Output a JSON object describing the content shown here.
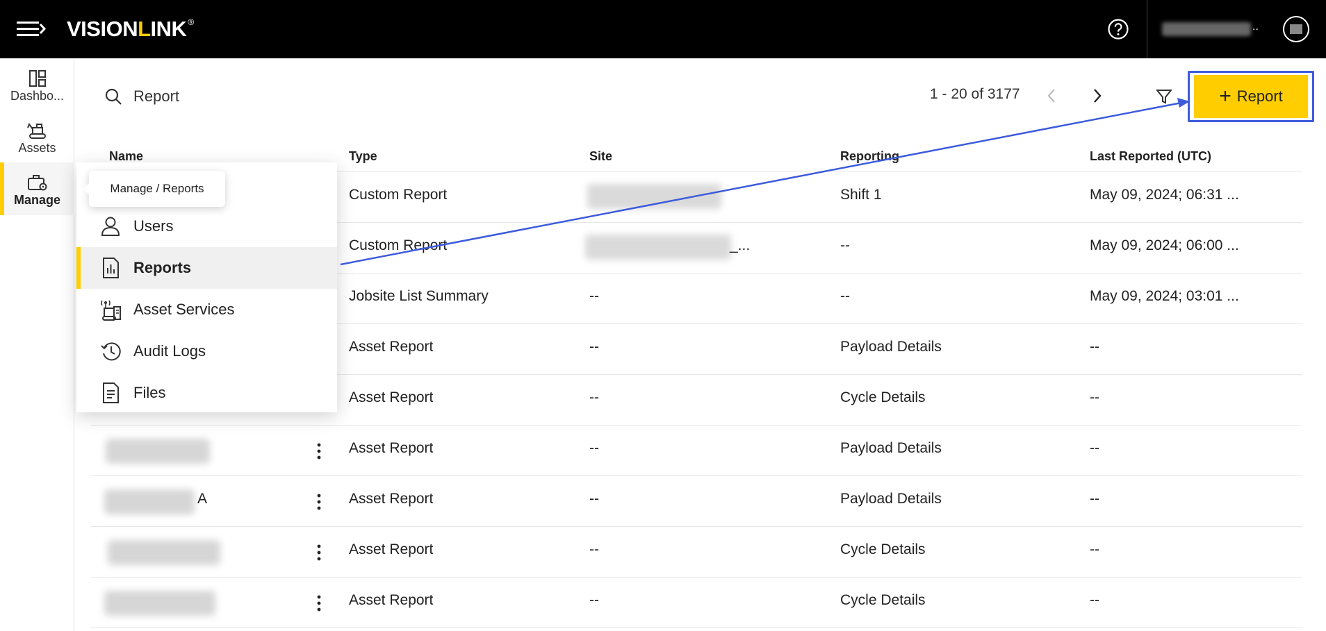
{
  "header": {
    "logo_text_1": "VISION",
    "logo_text_l": "L",
    "logo_text_2": "INK",
    "logo_reg": "®",
    "user_ellipsis": ".."
  },
  "leftnav": {
    "items": [
      {
        "label": "Dashbo..."
      },
      {
        "label": "Assets"
      },
      {
        "label": "Manage"
      }
    ]
  },
  "toolbar": {
    "search_value": "Report",
    "pagination": "1 - 20 of 3177",
    "add_report_label": "Report"
  },
  "table": {
    "headers": [
      "Name",
      "Type",
      "Site",
      "Reporting",
      "Last Reported (UTC)"
    ],
    "rows": [
      {
        "type": "Custom Report",
        "site": "",
        "reporting": "Shift 1",
        "last": "May 09, 2024; 06:31 ..."
      },
      {
        "type": "Custom Report",
        "site": "_...",
        "reporting": "--",
        "last": "May 09, 2024; 06:00 ..."
      },
      {
        "type": "Jobsite List Summary",
        "site": "--",
        "reporting": "--",
        "last": "May 09, 2024; 03:01 ..."
      },
      {
        "type": "Asset Report",
        "site": "--",
        "reporting": "Payload Details",
        "last": "--"
      },
      {
        "type": "Asset Report",
        "site": "--",
        "reporting": "Cycle Details",
        "last": "--"
      },
      {
        "name_suffix": "",
        "type": "Asset Report",
        "site": "--",
        "reporting": "Payload Details",
        "last": "--"
      },
      {
        "name_suffix": "A",
        "type": "Asset Report",
        "site": "--",
        "reporting": "Payload Details",
        "last": "--"
      },
      {
        "name_suffix": "",
        "type": "Asset Report",
        "site": "--",
        "reporting": "Cycle Details",
        "last": "--"
      },
      {
        "name_suffix": "",
        "type": "Asset Report",
        "site": "--",
        "reporting": "Cycle Details",
        "last": "--"
      }
    ]
  },
  "manage_menu": {
    "tooltip": "Manage / Reports",
    "items": [
      {
        "label": "Users",
        "icon": "user-icon"
      },
      {
        "label": "Reports",
        "icon": "report-icon"
      },
      {
        "label": "Asset Services",
        "icon": "asset-services-icon"
      },
      {
        "label": "Audit Logs",
        "icon": "history-icon"
      },
      {
        "label": "Files",
        "icon": "file-icon"
      }
    ]
  },
  "colors": {
    "accent": "#ffcd00",
    "topbar": "#000000",
    "annotation": "#3d5bdb"
  }
}
